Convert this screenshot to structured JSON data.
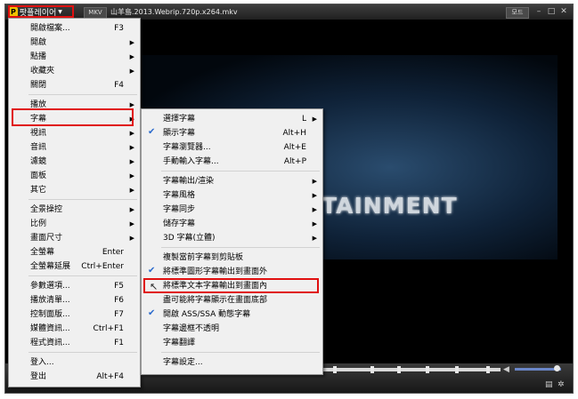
{
  "titlebar": {
    "app_name": "팟플레이어",
    "format": "MKV",
    "title": "山羊島.2013.Webrip.720p.x264.mkv",
    "mode": "모드"
  },
  "video": {
    "brand_text": "TAINMENT"
  },
  "main_menu": [
    {
      "label": "開啟檔案...",
      "shortcut": "F3"
    },
    {
      "label": "開啟",
      "arrow": true
    },
    {
      "label": "點播",
      "arrow": true
    },
    {
      "label": "收藏夾",
      "arrow": true
    },
    {
      "label": "關閉",
      "shortcut": "F4"
    },
    {
      "label": "播放",
      "arrow": true
    },
    {
      "label": "字幕",
      "arrow": true
    },
    {
      "label": "視訊",
      "arrow": true
    },
    {
      "label": "音訊",
      "arrow": true
    },
    {
      "label": "濾鏡",
      "arrow": true
    },
    {
      "label": "面板",
      "arrow": true
    },
    {
      "label": "其它",
      "arrow": true
    },
    {
      "label": "全景操控",
      "arrow": true
    },
    {
      "label": "比例",
      "arrow": true
    },
    {
      "label": "畫面尺寸",
      "arrow": true
    },
    {
      "label": "全螢幕",
      "shortcut": "Enter"
    },
    {
      "label": "全螢幕延展",
      "shortcut": "Ctrl+Enter"
    },
    {
      "label": "參數選項...",
      "shortcut": "F5"
    },
    {
      "label": "播放清單...",
      "shortcut": "F6"
    },
    {
      "label": "控制面版...",
      "shortcut": "F7"
    },
    {
      "label": "媒體資訊...",
      "shortcut": "Ctrl+F1"
    },
    {
      "label": "程式資訊...",
      "shortcut": "F1"
    },
    {
      "label": "登入..."
    },
    {
      "label": "登出",
      "shortcut": "Alt+F4"
    }
  ],
  "sub_menu": [
    {
      "label": "選擇字幕",
      "shortcut": "L",
      "arrow": true
    },
    {
      "label": "顯示字幕",
      "shortcut": "Alt+H",
      "checked": true
    },
    {
      "label": "字幕瀏覽器...",
      "shortcut": "Alt+E"
    },
    {
      "label": "手動輸入字幕...",
      "shortcut": "Alt+P"
    },
    {
      "label": "字幕輸出/渲染",
      "arrow": true
    },
    {
      "label": "字幕風格",
      "arrow": true
    },
    {
      "label": "字幕同步",
      "arrow": true
    },
    {
      "label": "儲存字幕",
      "arrow": true
    },
    {
      "label": "3D 字幕(立體)",
      "arrow": true
    },
    {
      "label": "複製當前字幕到剪貼板"
    },
    {
      "label": "將標準圖形字幕輸出到畫面外",
      "checked": true
    },
    {
      "label": "將標準文本字幕輸出到畫面內"
    },
    {
      "label": "盡可能將字幕顯示在畫面底部"
    },
    {
      "label": "開啟 ASS/SSA 動態字幕",
      "checked": true
    },
    {
      "label": "字幕邊框不透明"
    },
    {
      "label": "字幕翻譯"
    },
    {
      "label": "字幕設定..."
    }
  ],
  "icons": {
    "dropdown": "chevron-down-icon",
    "submenu_arrow": "arrow-right-icon",
    "check": "checkmark-icon",
    "minimize": "minimize-icon",
    "maximize": "maximize-icon",
    "close": "close-icon",
    "volume": "volume-icon",
    "playlist": "playlist-icon",
    "settings": "gear-icon"
  },
  "colors": {
    "highlight_box": "#e01010",
    "check": "#2a6acc",
    "menu_bg": "#f0f0f0",
    "volume_bar": "#6a86c8"
  },
  "volume_level": 0.85
}
